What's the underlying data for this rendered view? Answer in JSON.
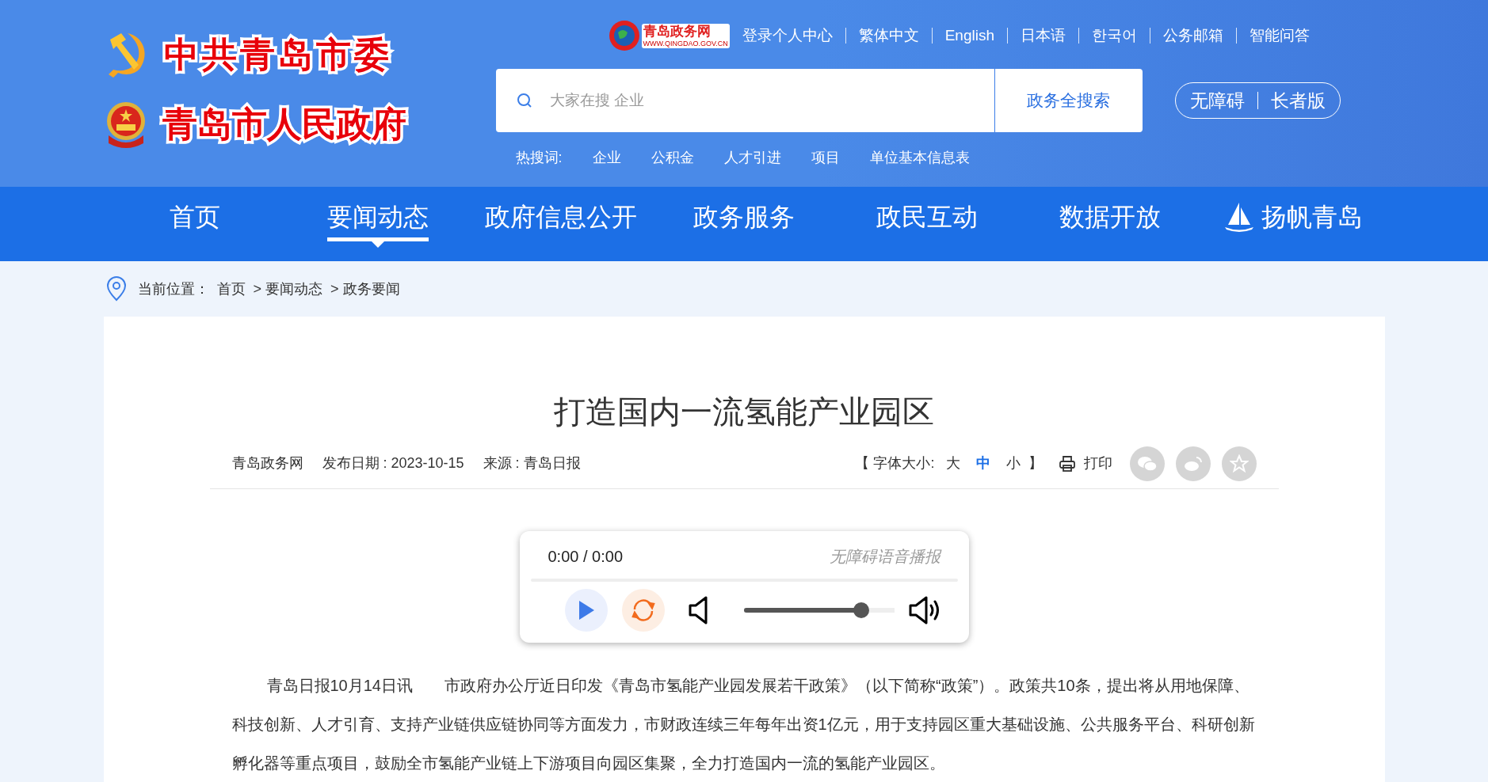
{
  "header": {
    "party_title": "中共青岛市委",
    "gov_title": "青岛市人民政府",
    "portal_logo": {
      "name": "青岛政务网",
      "url": "WWW.QINGDAO.GOV.CN"
    },
    "top_links": [
      "登录个人中心",
      "繁体中文",
      "English",
      "日本语",
      "한국어",
      "公务邮箱",
      "智能问答"
    ],
    "search": {
      "placeholder": "大家在搜 企业",
      "button": "政务全搜索"
    },
    "access": [
      "无障碍",
      "长者版"
    ],
    "hot_label": "热搜词:",
    "hot_words": [
      "企业",
      "公积金",
      "人才引进",
      "项目",
      "单位基本信息表"
    ]
  },
  "nav": [
    {
      "label": "首页",
      "selected": false,
      "kind": "plain"
    },
    {
      "label": "要闻动态",
      "selected": true,
      "kind": "plain"
    },
    {
      "label": "政府信息公开",
      "selected": false,
      "kind": "plain"
    },
    {
      "label": "政务服务",
      "selected": false,
      "kind": "plain"
    },
    {
      "label": "政民互动",
      "selected": false,
      "kind": "plain"
    },
    {
      "label": "数据开放",
      "selected": false,
      "kind": "plain"
    },
    {
      "label": "扬帆青岛",
      "selected": false,
      "kind": "sail"
    }
  ],
  "breadcrumb": {
    "label": "当前位置：",
    "items": [
      "首页",
      "> 要闻动态",
      "> 政务要闻"
    ]
  },
  "article": {
    "title": "打造国内一流氢能产业园区",
    "site": "青岛政务网",
    "date": "发布日期 : 2023-10-15",
    "source": "来源 : 青岛日报",
    "font_size": {
      "open": "【 字体大小:",
      "close": "】",
      "options": [
        {
          "label": "大",
          "selected": false
        },
        {
          "label": "中",
          "selected": true
        },
        {
          "label": "小",
          "selected": false
        }
      ]
    },
    "print": "打印",
    "player": {
      "time": "0:00 / 0:00",
      "caption": "无障碍语音播报",
      "volume": {
        "level": 0.78
      }
    },
    "paragraph": "青岛日报10月14日讯　　市政府办公厅近日印发《青岛市氢能产业园发展若干政策》（以下简称“政策”）。政策共10条，提出将从用地保障、科技创新、人才引育、支持产业链供应链协同等方面发力，市财政连续三年每年出资1亿元，用于支持园区重大基础设施、公共服务平台、科研创新孵化器等重点项目，鼓励全市氢能产业链上下游项目向园区集聚，全力打造国内一流的氢能产业园区。"
  }
}
